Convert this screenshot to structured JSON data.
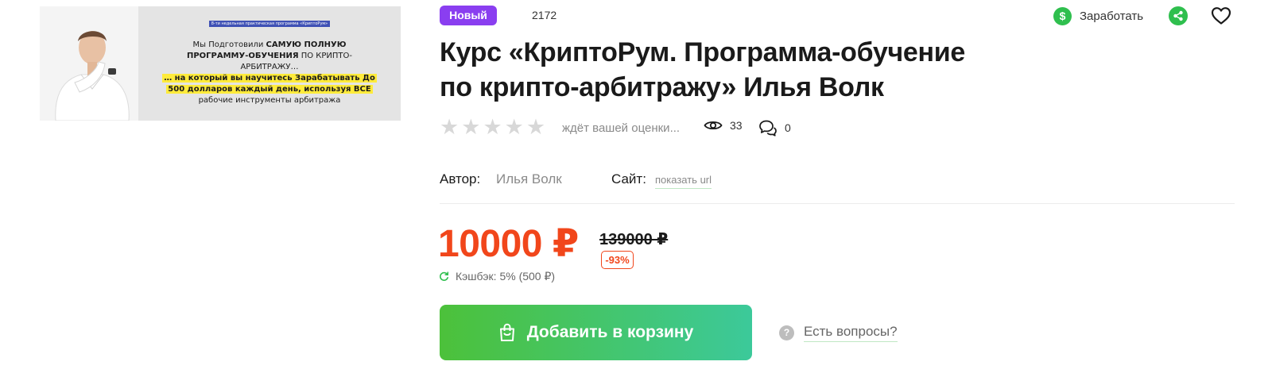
{
  "banner": {
    "tag": "8-ти недельная практическая программа «КриптоРум»",
    "line1": "Мы Подготовили",
    "line1_bold": "САМУЮ ПОЛНУЮ",
    "line2_bold": "ПРОГРАММУ-ОБУЧЕНИЯ",
    "line2": "ПО КРИПТО-",
    "line3": "АРБИТРАЖУ…",
    "hl1": "… на который вы научитесь Зарабатывать До",
    "hl2": "500 долларов каждый день, используя ВСЕ",
    "line4": "рабочие инструменты арбитража"
  },
  "badge": {
    "label": "Новый",
    "color": "#8a3ef0"
  },
  "product_code": "2172",
  "actions": {
    "earn_label": "Заработать",
    "earn_icon": "dollar-coin-icon",
    "share_icon": "share-icon",
    "favorite_icon": "heart-icon"
  },
  "title": {
    "line1": "Курс «КриптоРум. Программа-обучение",
    "line2": "по крипто-арбитражу» Илья Волк"
  },
  "rating": {
    "stars_total": 5,
    "stars_filled": 0,
    "text": "ждёт вашей оценки...",
    "views": "33",
    "comments": "0"
  },
  "meta": {
    "author_label": "Автор:",
    "author_name": "Илья Волк",
    "site_label": "Сайт:",
    "site_link": "показать url"
  },
  "price": {
    "current": "10000 ₽",
    "old": "139000 ₽",
    "discount": "-93%",
    "cashback": "Кэшбэк: 5% (500 ₽)",
    "accent_color": "#f1461b"
  },
  "cta": {
    "add_to_cart": "Добавить в корзину",
    "questions": "Есть вопросы?",
    "brand_green": "#4cc13a"
  }
}
